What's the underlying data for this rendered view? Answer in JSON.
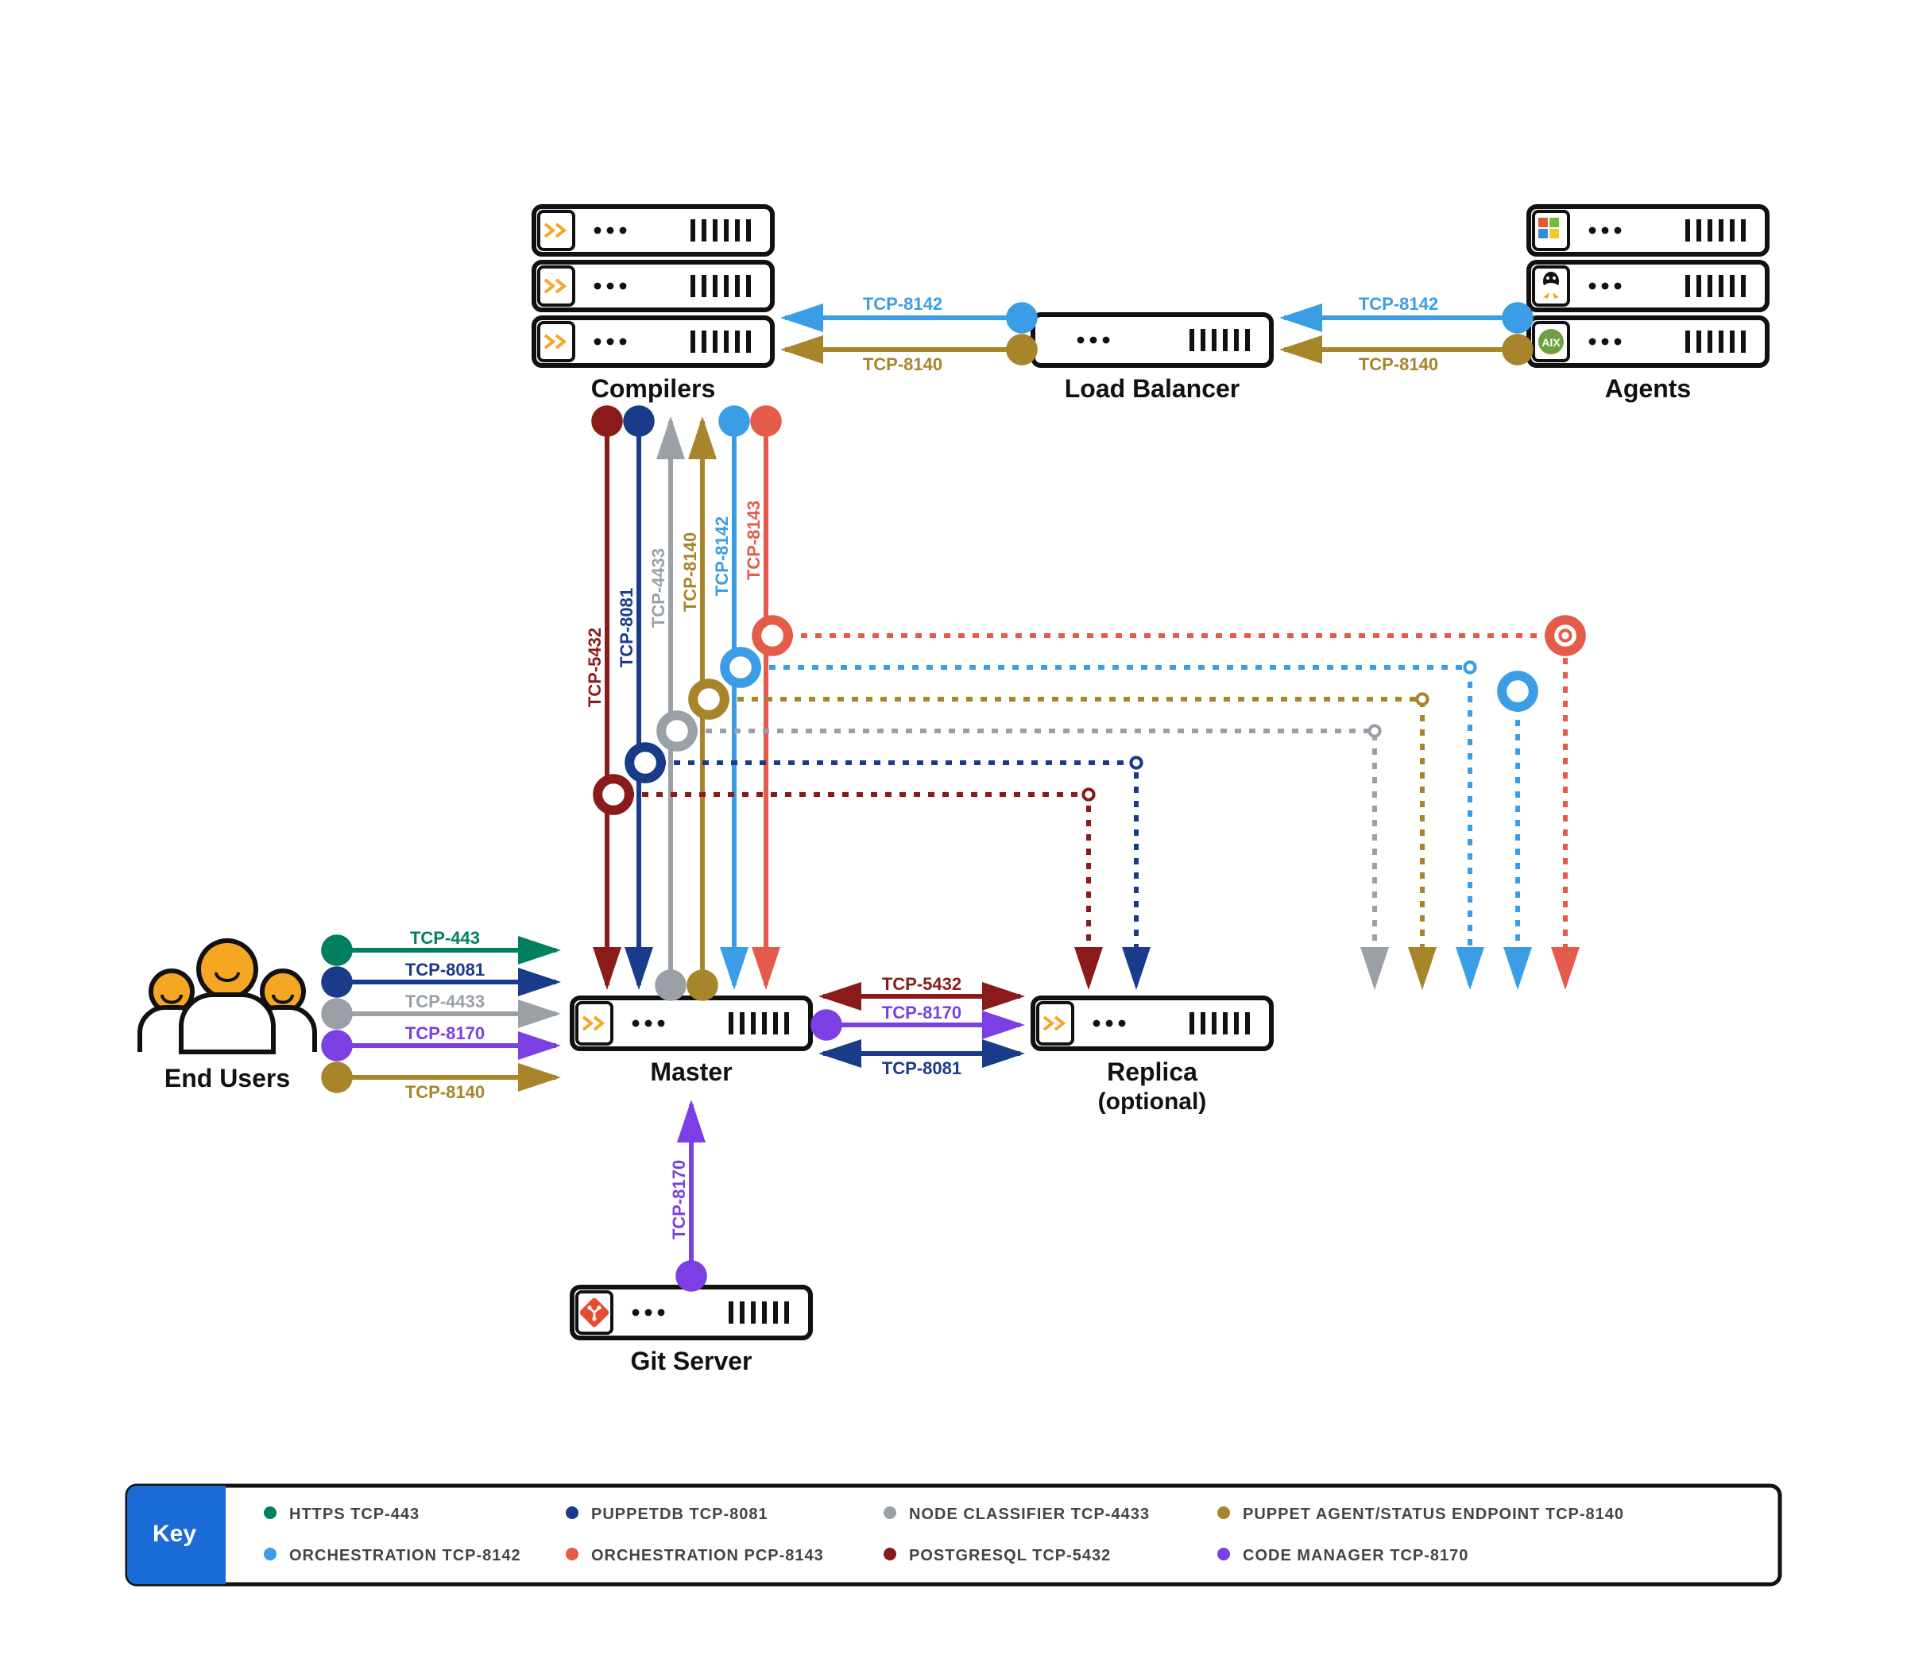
{
  "nodes": {
    "compilers": "Compilers",
    "loadbalancer": "Load Balancer",
    "agents": "Agents",
    "endusers": "End Users",
    "master": "Master",
    "replica1": "Replica",
    "replica2": "(optional)",
    "gitserver": "Git Server"
  },
  "ports": {
    "p8142": "TCP-8142",
    "p8140": "TCP-8140",
    "p443": "TCP-443",
    "p8081": "TCP-8081",
    "p4433": "TCP-4433",
    "p8170": "TCP-8170",
    "p5432": "TCP-5432",
    "p8143": "TCP-8143"
  },
  "key": {
    "title": "Key",
    "items": [
      {
        "label": "HTTPS TCP-443",
        "color": "#008060"
      },
      {
        "label": "PUPPETDB TCP-8081",
        "color": "#1a3a8a"
      },
      {
        "label": "NODE CLASSIFIER TCP-4433",
        "color": "#9aa0a6"
      },
      {
        "label": "PUPPET AGENT/STATUS ENDPOINT TCP-8140",
        "color": "#a8842a"
      },
      {
        "label": "ORCHESTRATION TCP-8142",
        "color": "#3b9de6"
      },
      {
        "label": "ORCHESTRATION PCP-8143",
        "color": "#e45b4a"
      },
      {
        "label": "POSTGRESQL TCP-5432",
        "color": "#8b1a1a"
      },
      {
        "label": "CODE MANAGER TCP-8170",
        "color": "#7b3fe4"
      }
    ]
  },
  "colors": {
    "https": "#008060",
    "puppetdb": "#1a3a8a",
    "classifier": "#9aa0a6",
    "agent": "#a8842a",
    "orch8142": "#3b9de6",
    "orch8143": "#e45b4a",
    "postgres": "#8b1a1a",
    "codemgr": "#7b3fe4",
    "orange": "#f5a623",
    "box": "#111"
  }
}
